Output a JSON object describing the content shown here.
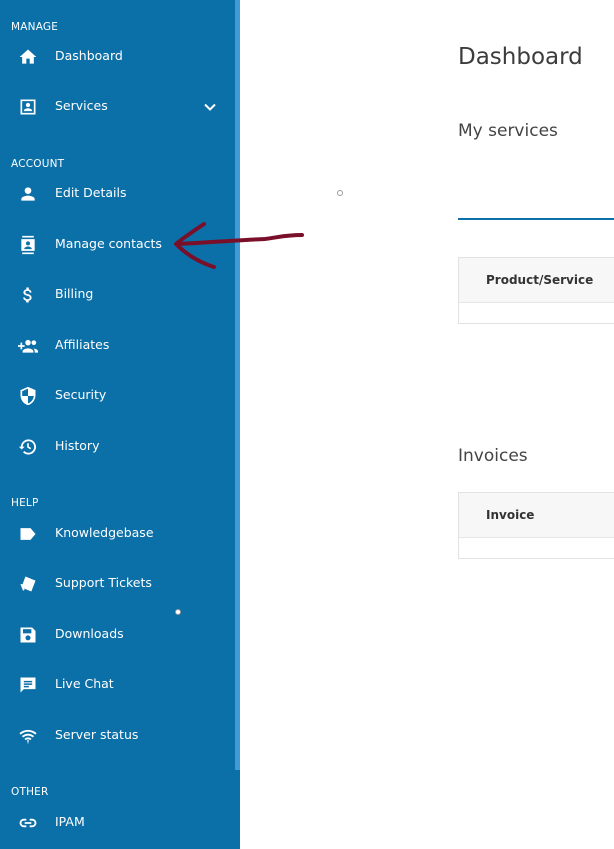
{
  "sidebar": {
    "sections": {
      "manage": "MANAGE",
      "account": "ACCOUNT",
      "help": "HELP",
      "other": "OTHER"
    },
    "items": {
      "dashboard": "Dashboard",
      "services": "Services",
      "edit_details": "Edit Details",
      "manage_contacts": "Manage contacts",
      "billing": "Billing",
      "affiliates": "Affiliates",
      "security": "Security",
      "history": "History",
      "knowledgebase": "Knowledgebase",
      "support_tickets": "Support Tickets",
      "downloads": "Downloads",
      "live_chat": "Live Chat",
      "server_status": "Server status",
      "ipam": "IPAM"
    }
  },
  "main": {
    "title": "Dashboard",
    "my_services": {
      "title": "My services",
      "column": "Product/Service"
    },
    "invoices": {
      "title": "Invoices",
      "column": "Invoice"
    }
  },
  "colors": {
    "sidebar_bg": "#0b6fa8",
    "accent": "#0b6fa8",
    "annotation_arrow": "#7a0f2a"
  },
  "icons": {
    "dashboard": "home-icon",
    "services": "contact-card-icon",
    "edit_details": "person-icon",
    "manage_contacts": "contacts-icon",
    "billing": "dollar-icon",
    "affiliates": "group-add-icon",
    "security": "shield-icon",
    "history": "history-icon",
    "knowledgebase": "label-icon",
    "support_tickets": "ticket-icon",
    "downloads": "save-icon",
    "live_chat": "chat-icon",
    "server_status": "signal-icon",
    "ipam": "link-icon"
  }
}
